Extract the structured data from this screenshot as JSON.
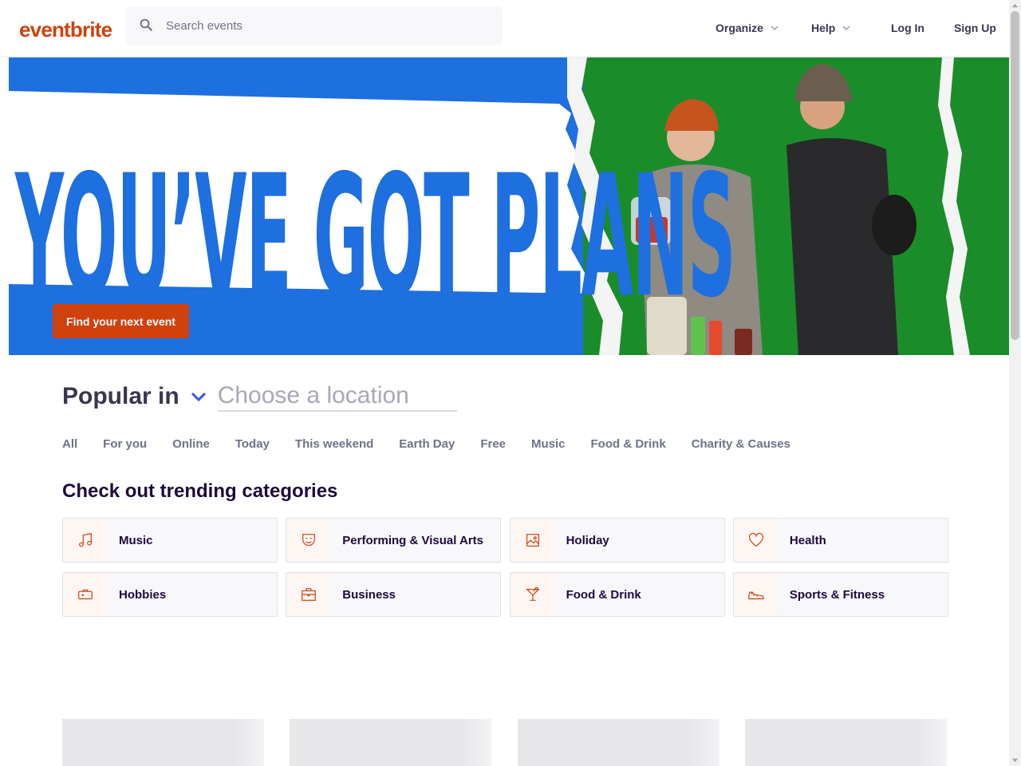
{
  "header": {
    "logo": "eventbrite",
    "search_placeholder": "Search events",
    "nav": {
      "organize": "Organize",
      "help": "Help",
      "login": "Log In",
      "signup": "Sign Up"
    }
  },
  "hero": {
    "headline": "YOU’VE GOT PLANS",
    "cta": "Find your next event"
  },
  "popular": {
    "label": "Popular in",
    "location_placeholder": "Choose a location",
    "tabs": [
      "All",
      "For you",
      "Online",
      "Today",
      "This weekend",
      "Earth Day",
      "Free",
      "Music",
      "Food & Drink",
      "Charity & Causes"
    ]
  },
  "trending": {
    "title": "Check out trending categories",
    "categories": [
      {
        "label": "Music",
        "icon": "music-note-icon"
      },
      {
        "label": "Performing & Visual Arts",
        "icon": "theater-mask-icon"
      },
      {
        "label": "Holiday",
        "icon": "picture-icon"
      },
      {
        "label": "Health",
        "icon": "heart-icon"
      },
      {
        "label": "Hobbies",
        "icon": "game-console-icon"
      },
      {
        "label": "Business",
        "icon": "briefcase-icon"
      },
      {
        "label": "Food & Drink",
        "icon": "cocktail-icon"
      },
      {
        "label": "Sports & Fitness",
        "icon": "sneaker-icon"
      }
    ]
  },
  "colors": {
    "brand": "#d1410c",
    "hero_blue": "#1e6fe0",
    "hero_green": "#1b8c2a",
    "accent": "#3659e3"
  }
}
